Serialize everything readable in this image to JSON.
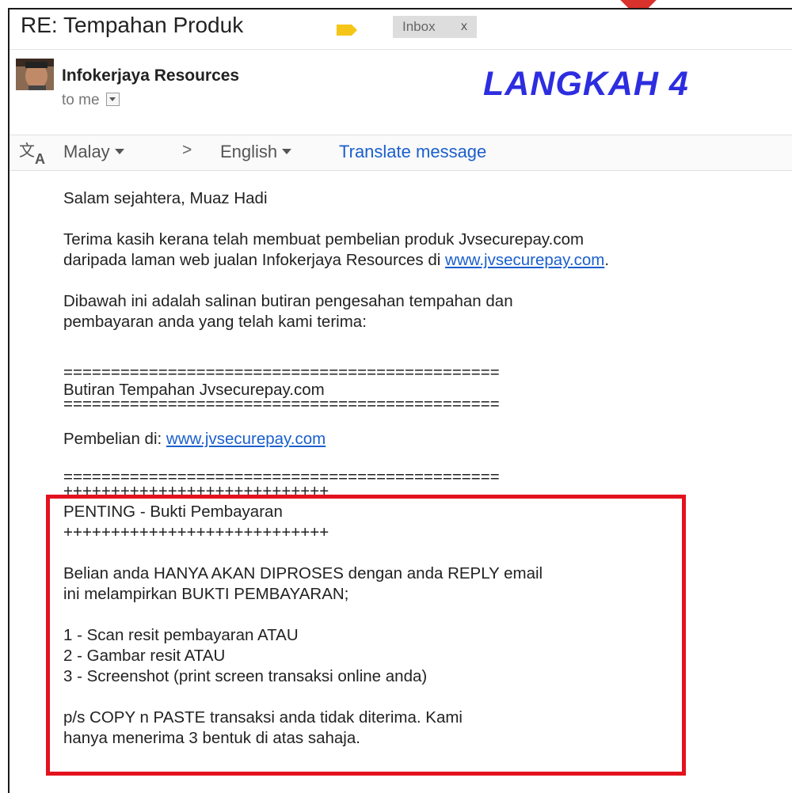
{
  "header": {
    "subject": "RE: Tempahan Produk",
    "inbox_chip": "Inbox",
    "chip_close": "x",
    "label_color": "#f5c518"
  },
  "sender": {
    "name": "Infokerjaya Resources",
    "recipient": "to me"
  },
  "banner": {
    "text": "LANGKAH 4",
    "color": "#2d2de0"
  },
  "translate": {
    "from_lang": "Malay",
    "arrow": ">",
    "to_lang": "English",
    "link": "Translate message"
  },
  "message": {
    "greeting": "Salam sejahtera, Muaz Hadi",
    "para1_line1": "Terima kasih kerana telah membuat pembelian produk Jvsecurepay.com",
    "para1_line2_prefix": "daripada laman web jualan Infokerjaya Resources di ",
    "para1_link": "www.jvsecurepay.com",
    "para1_suffix": ".",
    "para2_line1": "Dibawah ini adalah salinan butiran pengesahan tempahan dan",
    "para2_line2": "pembayaran anda yang telah kami terima:",
    "separator": "==============================================",
    "order_title": "Butiran Tempahan Jvsecurepay.com",
    "purchase_prefix": "Pembelian di: ",
    "purchase_link": "www.jvsecurepay.com",
    "plus_line": "++++++++++++++++++++++++++++",
    "important_title": "PENTING - Bukti Pembayaran",
    "notice_line1": "Belian anda HANYA AKAN DIPROSES dengan anda REPLY email",
    "notice_line2": "ini melampirkan BUKTI PEMBAYARAN;",
    "option1": "1 - Scan resit pembayaran ATAU",
    "option2": "2 - Gambar resit ATAU",
    "option3": "3 - Screenshot (print screen transaksi online anda)",
    "ps_line1": "p/s COPY n PASTE transaksi anda tidak diterima. Kami",
    "ps_line2": "hanya menerima 3 bentuk di atas sahaja."
  },
  "highlight_color": "#e3121e",
  "link_color": "#1a5fcc"
}
